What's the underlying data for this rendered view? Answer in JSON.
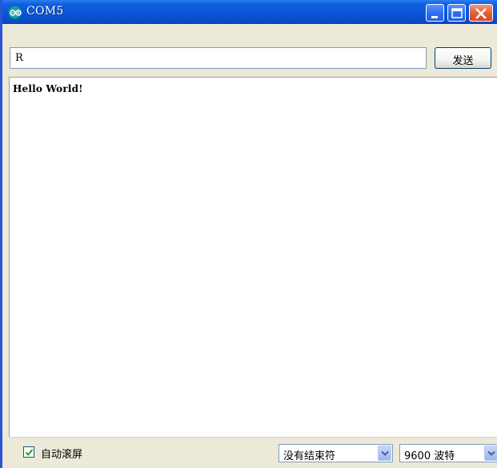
{
  "window": {
    "title": "COM5"
  },
  "send": {
    "input_value": "R",
    "button_label": "发送"
  },
  "output": {
    "text": "Hello World!"
  },
  "footer": {
    "autoscroll_label": "自动滚屏",
    "autoscroll_checked": true,
    "line_ending": {
      "selected": "没有结束符"
    },
    "baud_rate": {
      "selected": "9600 波特"
    }
  },
  "colors": {
    "title_bar": "#0b54d8",
    "window_bg": "#ece9d8",
    "close_button": "#e2603c",
    "arduino_icon": "#13a3a8"
  },
  "icons": {
    "app": "arduino-logo-icon",
    "minimize": "minimize-icon",
    "maximize": "maximize-icon",
    "close": "close-icon",
    "checkbox": "checkmark-icon",
    "dropdown": "chevron-down-icon"
  }
}
